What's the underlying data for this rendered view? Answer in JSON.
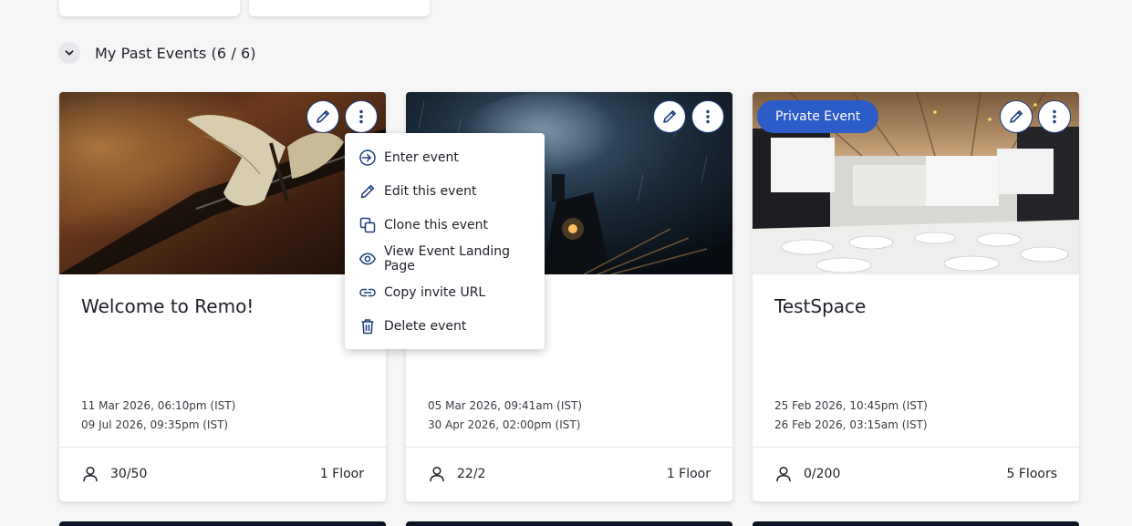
{
  "section": {
    "title": "My Past Events (6 / 6)"
  },
  "events": [
    {
      "title": "Welcome to Remo!",
      "start": "11 Mar 2026, 06:10pm (IST)",
      "end": "09 Jul 2026, 09:35pm (IST)",
      "attendees": "30/50",
      "floors": "1 Floor"
    },
    {
      "title": "",
      "start": "05 Mar 2026, 09:41am (IST)",
      "end": "30 Apr 2026, 02:00pm (IST)",
      "attendees": "22/2",
      "floors": "1 Floor"
    },
    {
      "title": "TestSpace",
      "start": "25 Feb 2026, 10:45pm (IST)",
      "end": "26 Feb 2026, 03:15am (IST)",
      "attendees": "0/200",
      "floors": "5 Floors",
      "badge": "Private Event"
    }
  ],
  "menu": {
    "items": [
      {
        "label": "Enter event",
        "icon": "enter-icon"
      },
      {
        "label": "Edit this event",
        "icon": "pencil-icon"
      },
      {
        "label": "Clone this event",
        "icon": "clone-icon"
      },
      {
        "label": "View Event Landing Page",
        "icon": "eye-icon"
      },
      {
        "label": "Copy invite URL",
        "icon": "link-icon"
      },
      {
        "label": "Delete event",
        "icon": "trash-icon"
      }
    ]
  },
  "colors": {
    "accent": "#1e3d7d",
    "badge": "#2b5cc7",
    "background": "#f6f6f7"
  }
}
